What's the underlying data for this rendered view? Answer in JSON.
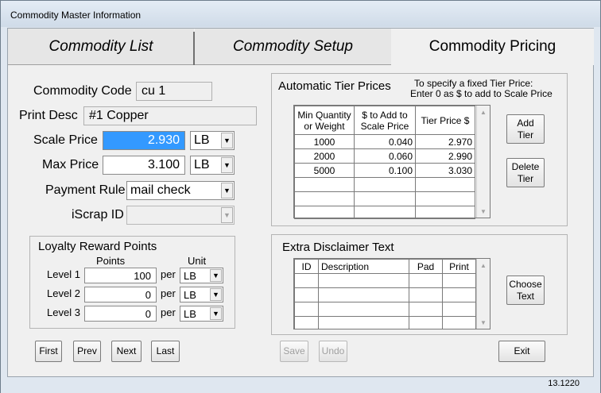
{
  "window": {
    "title": "Commodity Master Information",
    "version": "13.1220"
  },
  "tabs": [
    "Commodity List",
    "Commodity Setup",
    "Commodity Pricing"
  ],
  "form": {
    "commodity_code_label": "Commodity Code",
    "commodity_code": "cu 1",
    "print_desc_label": "Print Desc",
    "print_desc": "#1 Copper",
    "scale_price_label": "Scale Price",
    "scale_price": "2.930",
    "scale_unit": "LB",
    "max_price_label": "Max Price",
    "max_price": "3.100",
    "max_unit": "LB",
    "payment_rule_label": "Payment Rule",
    "payment_rule": "mail check",
    "iscrap_id_label": "iScrap ID",
    "iscrap_id": ""
  },
  "loyalty": {
    "title": "Loyalty Reward Points",
    "points_header": "Points",
    "unit_header": "Unit",
    "per": "per",
    "levels": [
      {
        "label": "Level 1",
        "points": "100",
        "unit": "LB"
      },
      {
        "label": "Level 2",
        "points": "0",
        "unit": "LB"
      },
      {
        "label": "Level 3",
        "points": "0",
        "unit": "LB"
      }
    ]
  },
  "tier": {
    "title": "Automatic Tier Prices",
    "note_line1": "To specify a fixed Tier Price:",
    "note_line2": "Enter 0 as $ to add to Scale Price",
    "headers": [
      "Min Quantity or Weight",
      "$ to Add to Scale Price",
      "Tier Price $"
    ],
    "rows": [
      [
        "1000",
        "0.040",
        "2.970"
      ],
      [
        "2000",
        "0.060",
        "2.990"
      ],
      [
        "5000",
        "0.100",
        "3.030"
      ]
    ],
    "add_label": "Add Tier",
    "delete_label": "Delete Tier"
  },
  "disclaimer": {
    "title": "Extra Disclaimer Text",
    "headers": [
      "ID",
      "Description",
      "Pad",
      "Print"
    ],
    "choose_label": "Choose Text"
  },
  "nav": {
    "first": "First",
    "prev": "Prev",
    "next": "Next",
    "last": "Last"
  },
  "actions": {
    "save": "Save",
    "undo": "Undo",
    "exit": "Exit"
  }
}
